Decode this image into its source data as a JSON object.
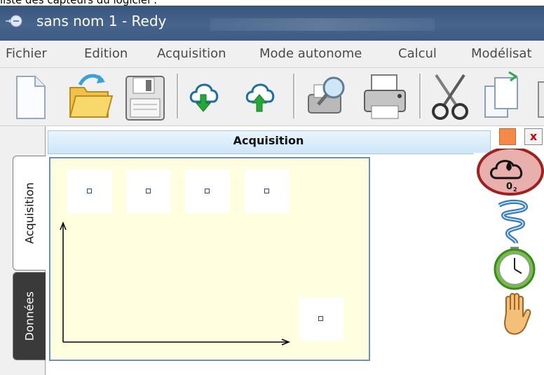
{
  "caption": "liste des capteurs du logiciel :",
  "window": {
    "title": "sans nom 1 - Redy"
  },
  "menu": [
    "Fichier",
    "Edition",
    "Acquisition",
    "Mode autonome",
    "Calcul",
    "Modélisat"
  ],
  "toolbar": {
    "buttons": [
      "new-document-icon",
      "open-folder-icon",
      "save-disk-icon",
      "download-cloud-icon",
      "upload-cloud-icon",
      "print-preview-icon",
      "print-icon",
      "cut-scissors-icon",
      "copy-icon",
      "paste-icon"
    ]
  },
  "side_tabs": {
    "acquisition": "Acquisition",
    "donnees": "Données"
  },
  "panel": {
    "title": "Acquisition",
    "close_glyph": "x"
  },
  "sensor_slots": 5,
  "right_tools": [
    "o2-sensor-icon",
    "vortex-icon",
    "stopwatch-icon",
    "hand-icon"
  ],
  "colors": {
    "title_bar": "#3d5a82",
    "plot_bg": "#ffffdf",
    "panel_header": "#cde6f8",
    "highlight": "#e8b0ad"
  }
}
